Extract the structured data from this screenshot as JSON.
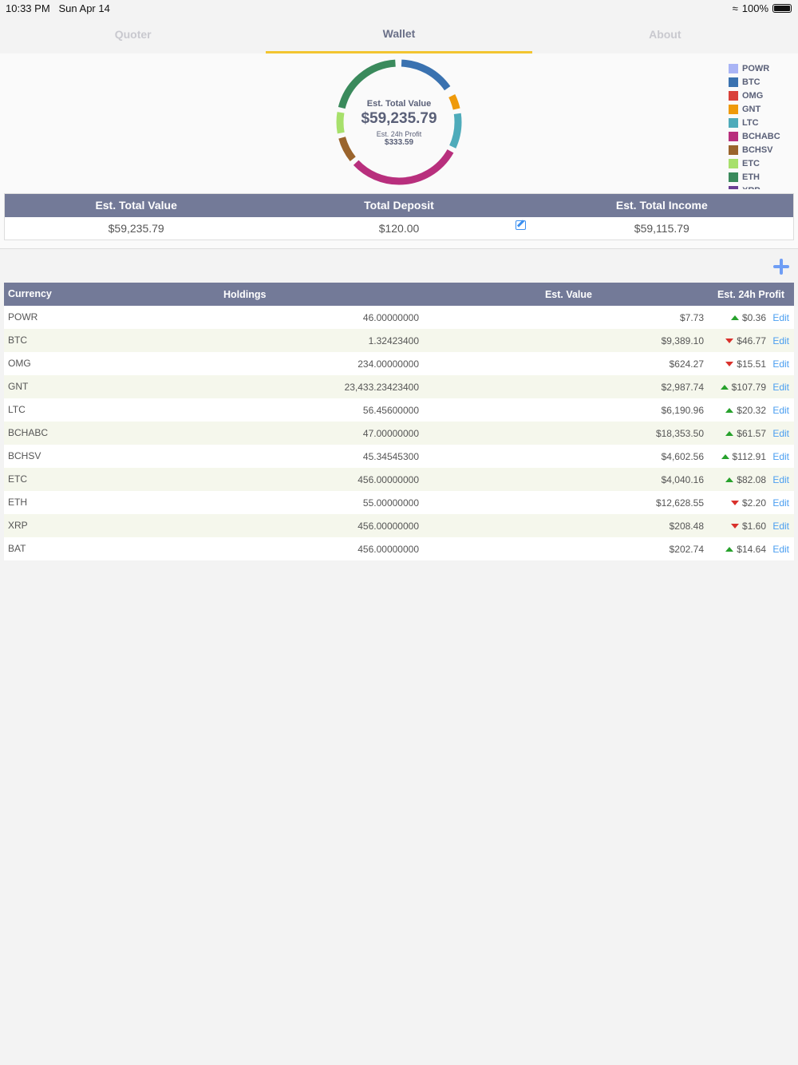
{
  "status": {
    "time": "10:33 PM",
    "date": "Sun Apr 14",
    "battery": "100%"
  },
  "tabs": [
    {
      "label": "Quoter"
    },
    {
      "label": "Wallet"
    },
    {
      "label": "About"
    }
  ],
  "center": {
    "title": "Est. Total Value",
    "value": "$59,235.79",
    "profit_label": "Est. 24h Profit",
    "profit": "$333.59"
  },
  "chart_data": {
    "type": "pie",
    "title": "Est. Total Value",
    "series": [
      {
        "name": "POWR",
        "value": 7.73,
        "color": "#a9b4f5"
      },
      {
        "name": "BTC",
        "value": 9389.1,
        "color": "#3a72b0"
      },
      {
        "name": "OMG",
        "value": 624.27,
        "color": "#d9413a"
      },
      {
        "name": "GNT",
        "value": 2987.74,
        "color": "#ef9a0b"
      },
      {
        "name": "LTC",
        "value": 6190.96,
        "color": "#4eabba"
      },
      {
        "name": "BCHABC",
        "value": 18353.5,
        "color": "#b82f7d"
      },
      {
        "name": "BCHSV",
        "value": 4602.56,
        "color": "#9a642c"
      },
      {
        "name": "ETC",
        "value": 4040.16,
        "color": "#a7e06b"
      },
      {
        "name": "ETH",
        "value": 12628.55,
        "color": "#3a8a5c"
      },
      {
        "name": "XRP",
        "value": 208.48,
        "color": "#6a3f93"
      }
    ],
    "legend": "top-right"
  },
  "summary": {
    "headers": [
      "Est. Total Value",
      "Total Deposit",
      "Est. Total Income"
    ],
    "values": [
      "$59,235.79",
      "$120.00",
      "$59,115.79"
    ]
  },
  "table": {
    "headers": [
      "Currency",
      "Holdings",
      "Est. Value",
      "Est. 24h Profit"
    ],
    "edit_label": "Edit",
    "rows": [
      {
        "currency": "POWR",
        "holdings": "46.00000000",
        "value": "$7.73",
        "profit": "$0.36",
        "dir": "up"
      },
      {
        "currency": "BTC",
        "holdings": "1.32423400",
        "value": "$9,389.10",
        "profit": "$46.77",
        "dir": "down"
      },
      {
        "currency": "OMG",
        "holdings": "234.00000000",
        "value": "$624.27",
        "profit": "$15.51",
        "dir": "down"
      },
      {
        "currency": "GNT",
        "holdings": "23,433.23423400",
        "value": "$2,987.74",
        "profit": "$107.79",
        "dir": "up"
      },
      {
        "currency": "LTC",
        "holdings": "56.45600000",
        "value": "$6,190.96",
        "profit": "$20.32",
        "dir": "up"
      },
      {
        "currency": "BCHABC",
        "holdings": "47.00000000",
        "value": "$18,353.50",
        "profit": "$61.57",
        "dir": "up"
      },
      {
        "currency": "BCHSV",
        "holdings": "45.34545300",
        "value": "$4,602.56",
        "profit": "$112.91",
        "dir": "up"
      },
      {
        "currency": "ETC",
        "holdings": "456.00000000",
        "value": "$4,040.16",
        "profit": "$82.08",
        "dir": "up"
      },
      {
        "currency": "ETH",
        "holdings": "55.00000000",
        "value": "$12,628.55",
        "profit": "$2.20",
        "dir": "down"
      },
      {
        "currency": "XRP",
        "holdings": "456.00000000",
        "value": "$208.48",
        "profit": "$1.60",
        "dir": "down"
      },
      {
        "currency": "BAT",
        "holdings": "456.00000000",
        "value": "$202.74",
        "profit": "$14.64",
        "dir": "up"
      }
    ]
  }
}
